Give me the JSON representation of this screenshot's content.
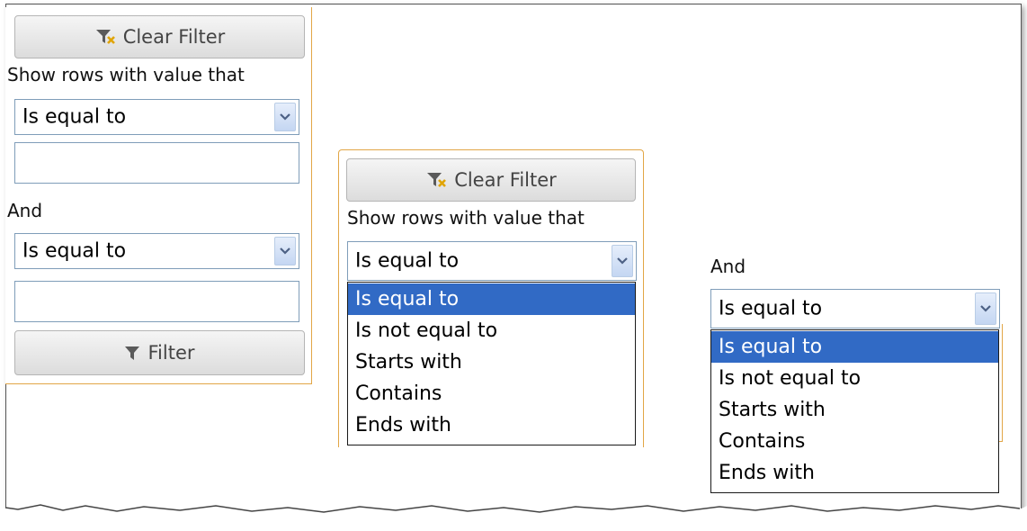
{
  "panels": [
    {
      "clear_filter": "Clear Filter",
      "show_rows": "Show rows with value that",
      "operator1": "Is equal to",
      "logic": "And",
      "operator2": "Is equal to",
      "filter": "Filter"
    },
    {
      "clear_filter": "Clear Filter",
      "show_rows": "Show rows with value that",
      "operator1": "Is equal to",
      "options": [
        "Is equal to",
        "Is not equal to",
        "Starts with",
        "Contains",
        "Ends with"
      ],
      "selected_option": "Is equal to"
    },
    {
      "logic": "And",
      "operator2": "Is equal to",
      "options": [
        "Is equal to",
        "Is not equal to",
        "Starts with",
        "Contains",
        "Ends with"
      ],
      "selected_option": "Is equal to"
    }
  ],
  "icons": {
    "clear_filter": "clear-filter-icon",
    "filter": "filter-icon",
    "dropdown": "chevron-down-icon"
  },
  "colors": {
    "panel_border": "#e2a646",
    "selection": "#316ac5",
    "input_border": "#7f9db9"
  }
}
